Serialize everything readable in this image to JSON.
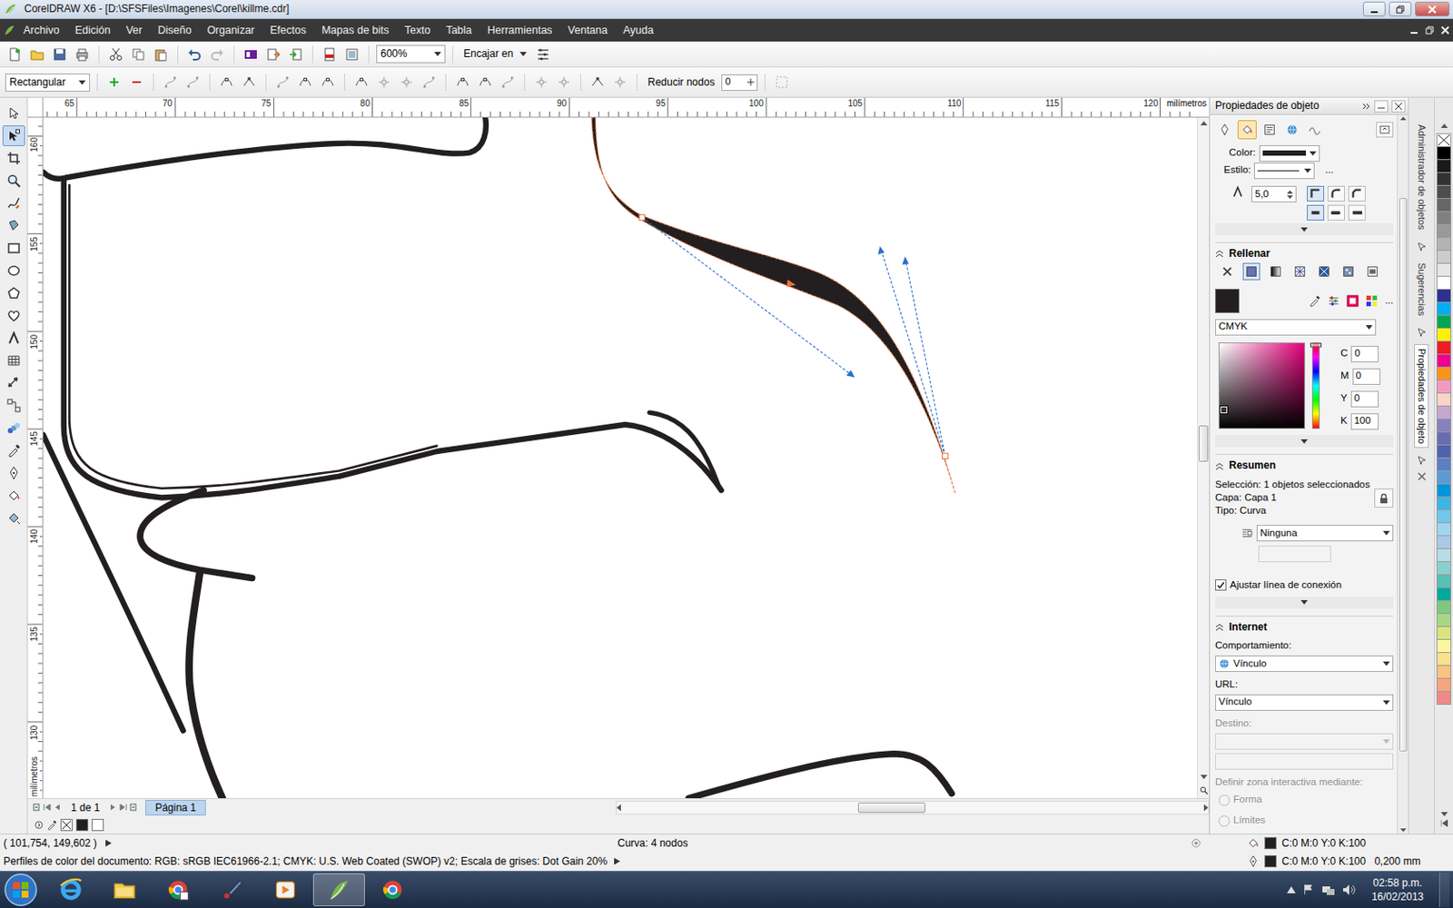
{
  "window": {
    "title": "CorelDRAW X6 - [D:\\SFSFiles\\Imagenes\\Corel\\killme.cdr]"
  },
  "menu": [
    "Archivo",
    "Edición",
    "Ver",
    "Diseño",
    "Organizar",
    "Efectos",
    "Mapas de bits",
    "Texto",
    "Tabla",
    "Herramientas",
    "Ventana",
    "Ayuda"
  ],
  "toolbar": {
    "zoom": "600%",
    "snap": "Encajar en"
  },
  "property_bar": {
    "mode": "Rectangular",
    "reduce_label": "Reducir nodos",
    "reduce_value": "0"
  },
  "tools": [
    {
      "kind": "pick",
      "selected": false
    },
    {
      "kind": "shape",
      "selected": true
    },
    {
      "kind": "crop",
      "selected": false
    },
    {
      "kind": "zoom",
      "selected": false
    },
    {
      "kind": "freehand",
      "selected": false
    },
    {
      "kind": "smartfill",
      "selected": false
    },
    {
      "kind": "rectangle",
      "selected": false
    },
    {
      "kind": "ellipse",
      "selected": false
    },
    {
      "kind": "polygon",
      "selected": false
    },
    {
      "kind": "basicshapes",
      "selected": false
    },
    {
      "kind": "text",
      "selected": false
    },
    {
      "kind": "table",
      "selected": false
    },
    {
      "kind": "dimension",
      "selected": false
    },
    {
      "kind": "connector",
      "selected": false
    },
    {
      "kind": "blend",
      "selected": false
    },
    {
      "kind": "dropper",
      "selected": false
    },
    {
      "kind": "outline",
      "selected": false
    },
    {
      "kind": "fill",
      "selected": false
    },
    {
      "kind": "interactivefill",
      "selected": false
    }
  ],
  "rulers": {
    "unit": "milímetros",
    "top": [
      "65",
      "70",
      "75",
      "80",
      "85",
      "90",
      "95",
      "100",
      "105",
      "110",
      "115",
      "120"
    ],
    "left": [
      "160",
      "155",
      "150",
      "145",
      "140",
      "135",
      "130"
    ]
  },
  "scroll": {
    "h_level": 0.46,
    "v_level": 0.49
  },
  "page_nav": {
    "count": "1 de 1",
    "pages": [
      {
        "label": "Página 1",
        "selected": true
      }
    ]
  },
  "doc_palette": [
    {
      "color": "#231f20"
    },
    {
      "color": "#ffffff"
    }
  ],
  "docker": {
    "title": "Propiedades de objeto",
    "tabs": [
      {
        "kind": "outline",
        "selected": false
      },
      {
        "kind": "fill",
        "selected": true
      },
      {
        "kind": "summary",
        "selected": false
      },
      {
        "kind": "internet",
        "selected": false
      },
      {
        "kind": "curve",
        "selected": false
      }
    ],
    "outline": {
      "color_label": "Color:",
      "style_label": "Estilo:",
      "more": "...",
      "width": "5,0",
      "corners": [
        {
          "selected": true
        },
        {
          "selected": false
        },
        {
          "selected": false
        }
      ],
      "caps": [
        {
          "selected": true
        },
        {
          "selected": false
        },
        {
          "selected": false
        }
      ]
    },
    "fill": {
      "title": "Rellenar",
      "expanded": true,
      "types": [
        {
          "kind": "none",
          "selected": false
        },
        {
          "kind": "uniform",
          "selected": true
        },
        {
          "kind": "fountain",
          "selected": false
        },
        {
          "kind": "vector",
          "selected": false
        },
        {
          "kind": "bitmap",
          "selected": false
        },
        {
          "kind": "texture",
          "selected": false
        },
        {
          "kind": "postscript",
          "selected": false
        }
      ],
      "color": "#231f20",
      "more": "...",
      "model": "CMYK",
      "hue_level": 0.02,
      "picker": {
        "x": 0.05,
        "y": 0.78
      },
      "channels": [
        {
          "label": "C",
          "value": "0"
        },
        {
          "label": "M",
          "value": "0"
        },
        {
          "label": "Y",
          "value": "0"
        },
        {
          "label": "K",
          "value": "100"
        }
      ]
    },
    "summary": {
      "title": "Resumen",
      "expanded": true,
      "lines": [
        {
          "label": "Selección:",
          "value": "1 objetos seleccionados"
        },
        {
          "label": "Capa:",
          "value": "Capa 1"
        },
        {
          "label": "Tipo:",
          "value": "Curva"
        }
      ],
      "wrap": "Ninguna",
      "snap_label": "Ajustar línea de conexión",
      "snap_checked": true
    },
    "internet": {
      "title": "Internet",
      "expanded": true,
      "behavior_label": "Comportamiento:",
      "behavior": "Vínculo",
      "url_label": "URL:",
      "url": "Vínculo",
      "target_label": "Destino:",
      "zone_label": "Definir zona interactiva mediante:",
      "zone_options": [
        {
          "label": "Forma",
          "selected": false,
          "disabled": true
        },
        {
          "label": "Límites",
          "selected": false,
          "disabled": true
        }
      ]
    }
  },
  "side_tabs": [
    {
      "label": "Administrador de objetos",
      "selected": false
    },
    {
      "label": "Sugerencias",
      "selected": false
    },
    {
      "label": "Propiedades de objeto",
      "selected": true
    }
  ],
  "palette": [
    {
      "kind": "none"
    },
    {
      "kind": "swatch",
      "color": "#000000"
    },
    {
      "kind": "swatch",
      "color": "#1a1a1a"
    },
    {
      "kind": "swatch",
      "color": "#333333"
    },
    {
      "kind": "swatch",
      "color": "#4d4d4d"
    },
    {
      "kind": "swatch",
      "color": "#666666"
    },
    {
      "kind": "swatch",
      "color": "#808080"
    },
    {
      "kind": "swatch",
      "color": "#999999"
    },
    {
      "kind": "swatch",
      "color": "#b3b3b3"
    },
    {
      "kind": "swatch",
      "color": "#cccccc"
    },
    {
      "kind": "swatch",
      "color": "#e6e6e6"
    },
    {
      "kind": "swatch",
      "color": "#ffffff"
    },
    {
      "kind": "swatch",
      "color": "#2e3192"
    },
    {
      "kind": "swatch",
      "color": "#00aeef"
    },
    {
      "kind": "swatch",
      "color": "#00a651"
    },
    {
      "kind": "swatch",
      "color": "#fff200"
    },
    {
      "kind": "swatch",
      "color": "#ed1c24"
    },
    {
      "kind": "swatch",
      "color": "#ec008c"
    },
    {
      "kind": "swatch",
      "color": "#f7941d"
    },
    {
      "kind": "swatch",
      "color": "#f49ac1"
    },
    {
      "kind": "swatch",
      "color": "#fbd3c7"
    },
    {
      "kind": "swatch",
      "color": "#c4a6ce"
    },
    {
      "kind": "swatch",
      "color": "#8781bd"
    },
    {
      "kind": "swatch",
      "color": "#6a6bb1"
    },
    {
      "kind": "swatch",
      "color": "#4e63ad"
    },
    {
      "kind": "swatch",
      "color": "#5a7fc2"
    },
    {
      "kind": "swatch",
      "color": "#5b9bd5"
    },
    {
      "kind": "swatch",
      "color": "#0095da"
    },
    {
      "kind": "swatch",
      "color": "#3fb5e5"
    },
    {
      "kind": "swatch",
      "color": "#74c7ec"
    },
    {
      "kind": "swatch",
      "color": "#9fd5ef"
    },
    {
      "kind": "swatch",
      "color": "#aac9e4"
    },
    {
      "kind": "swatch",
      "color": "#b6dde8"
    },
    {
      "kind": "swatch",
      "color": "#8ad0d0"
    },
    {
      "kind": "swatch",
      "color": "#58c0b5"
    },
    {
      "kind": "swatch",
      "color": "#00a99d"
    },
    {
      "kind": "swatch",
      "color": "#7fc97f"
    },
    {
      "kind": "swatch",
      "color": "#a6d785"
    },
    {
      "kind": "swatch",
      "color": "#d7e57a"
    },
    {
      "kind": "swatch",
      "color": "#fdf6a1"
    },
    {
      "kind": "swatch",
      "color": "#fbe08c"
    },
    {
      "kind": "swatch",
      "color": "#f9c383"
    },
    {
      "kind": "swatch",
      "color": "#f6a57f"
    },
    {
      "kind": "swatch",
      "color": "#f08a8a"
    }
  ],
  "status_bar": {
    "coords": "( 101,754, 149,602 )",
    "object": "Curva: 4 nodos",
    "profiles": "Perfiles de color del documento: RGB: sRGB IEC61966-2.1; CMYK: U.S. Web Coated (SWOP) v2; Escala de grises: Dot Gain 20%",
    "fill": {
      "text": "C:0 M:0 Y:0 K:100",
      "color": "#231f20"
    },
    "outline": {
      "text": "C:0 M:0 Y:0 K:100",
      "color": "#231f20",
      "width": "0,200 mm"
    }
  },
  "taskbar": {
    "apps": [
      {
        "kind": "ie",
        "selected": false
      },
      {
        "kind": "explorer",
        "selected": false
      },
      {
        "kind": "chromedev",
        "selected": false
      },
      {
        "kind": "paint",
        "selected": false
      },
      {
        "kind": "media",
        "selected": false
      },
      {
        "kind": "corel",
        "selected": true
      },
      {
        "kind": "chrome",
        "selected": false
      }
    ],
    "time": "02:58 p.m.",
    "date": "16/02/2013"
  }
}
